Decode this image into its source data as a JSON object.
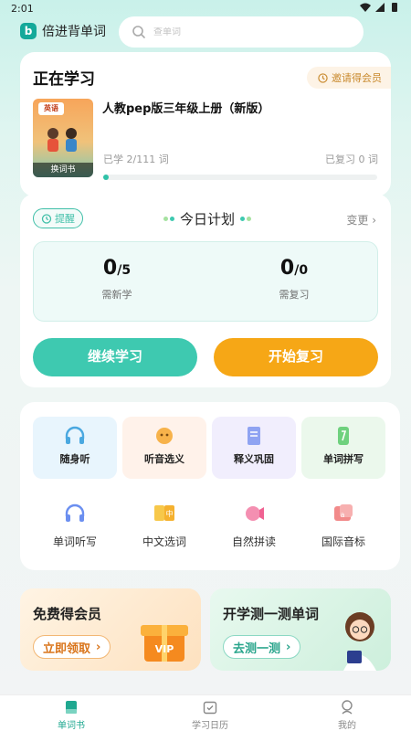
{
  "status_bar": {
    "time": "2:01"
  },
  "app": {
    "brand_letter": "b",
    "brand_name": "倍进背单词"
  },
  "search": {
    "placeholder": "查单词"
  },
  "study": {
    "title": "正在学习",
    "invite_label": "邀请得会员",
    "book_cover_title": "英语",
    "change_book_label": "换词书",
    "book_name": "人教pep版三年级上册（新版）",
    "learned_text": "已学 2/111 词",
    "reviewed_text": "已复习 0 词",
    "progress_fraction": 0.018
  },
  "plan": {
    "remind_label": "提醒",
    "title": "今日计划",
    "change_label": "变更",
    "new_count": "0",
    "new_total": "/5",
    "new_label": "需新学",
    "review_count": "0",
    "review_total": "/0",
    "review_label": "需复习",
    "continue_button": "继续学习",
    "review_button": "开始复习"
  },
  "tools_row1": [
    {
      "label": "随身听",
      "icon": "headphones-icon",
      "bg": "#e8f5fd"
    },
    {
      "label": "听音选义",
      "icon": "listen-choose-icon",
      "bg": "#fff2ea"
    },
    {
      "label": "释义巩固",
      "icon": "book-consolidate-icon",
      "bg": "#f1eefd"
    },
    {
      "label": "单词拼写",
      "icon": "spelling-icon",
      "bg": "#ebf8ec"
    }
  ],
  "tools_row2": [
    {
      "label": "单词听写",
      "icon": "dictation-icon"
    },
    {
      "label": "中文选词",
      "icon": "chinese-choose-icon"
    },
    {
      "label": "自然拼读",
      "icon": "phonics-icon"
    },
    {
      "label": "国际音标",
      "icon": "phonetic-symbol-icon"
    }
  ],
  "promos": {
    "vip_title": "免费得会员",
    "vip_button": "立即领取",
    "test_title": "开学测一测单词",
    "test_button": "去测一测"
  },
  "bottom_nav": [
    {
      "label": "单词书",
      "icon": "wordbook-icon",
      "active": true
    },
    {
      "label": "学习日历",
      "icon": "calendar-icon",
      "active": false
    },
    {
      "label": "我的",
      "icon": "profile-icon",
      "active": false
    }
  ],
  "colors": {
    "accent": "#3ec9b0",
    "orange": "#f6a716"
  }
}
